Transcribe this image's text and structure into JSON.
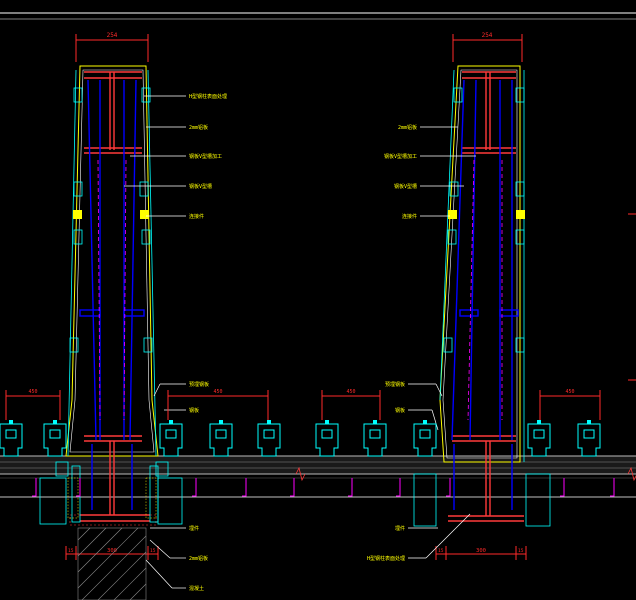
{
  "colors": {
    "background": "#000000",
    "dimension": "#ff2a2a",
    "steel": "#ff3a3a",
    "glass": "#0000ff",
    "mullion": "#00ffff",
    "cladding": "#ffff00",
    "leader": "#ffffff",
    "note_text": "#ffff00",
    "hatch": "#888888",
    "magenta": "#ff00ff"
  },
  "drawing": {
    "left_section": {
      "top_dimension": "254",
      "bottom_dimension": "300",
      "bottom_small_left": "15",
      "bottom_small_right": "15",
      "callouts": [
        "H型钢柱表面处理",
        "2mm铝板",
        "钢板V型槽加工",
        "钢板V型槽",
        "连接件"
      ],
      "bottom_callouts": [
        "埋件",
        "2mm铝板",
        "混凝土"
      ],
      "lower_callouts": [
        "预埋钢板",
        "钢板"
      ],
      "bay_dimensions": [
        "450",
        "450"
      ]
    },
    "right_section": {
      "top_dimension": "254",
      "bottom_dimension": "300",
      "bottom_small_left": "15",
      "bottom_small_right": "15",
      "callouts": [
        "2mm铝板",
        "钢板V型槽加工",
        "钢板V型槽",
        "连接件"
      ],
      "bottom_callouts": [
        "埋件",
        "H型钢柱表面处理"
      ],
      "lower_callouts": [
        "预埋钢板",
        "钢板"
      ],
      "bay_dimensions": [
        "450",
        "450"
      ]
    }
  }
}
